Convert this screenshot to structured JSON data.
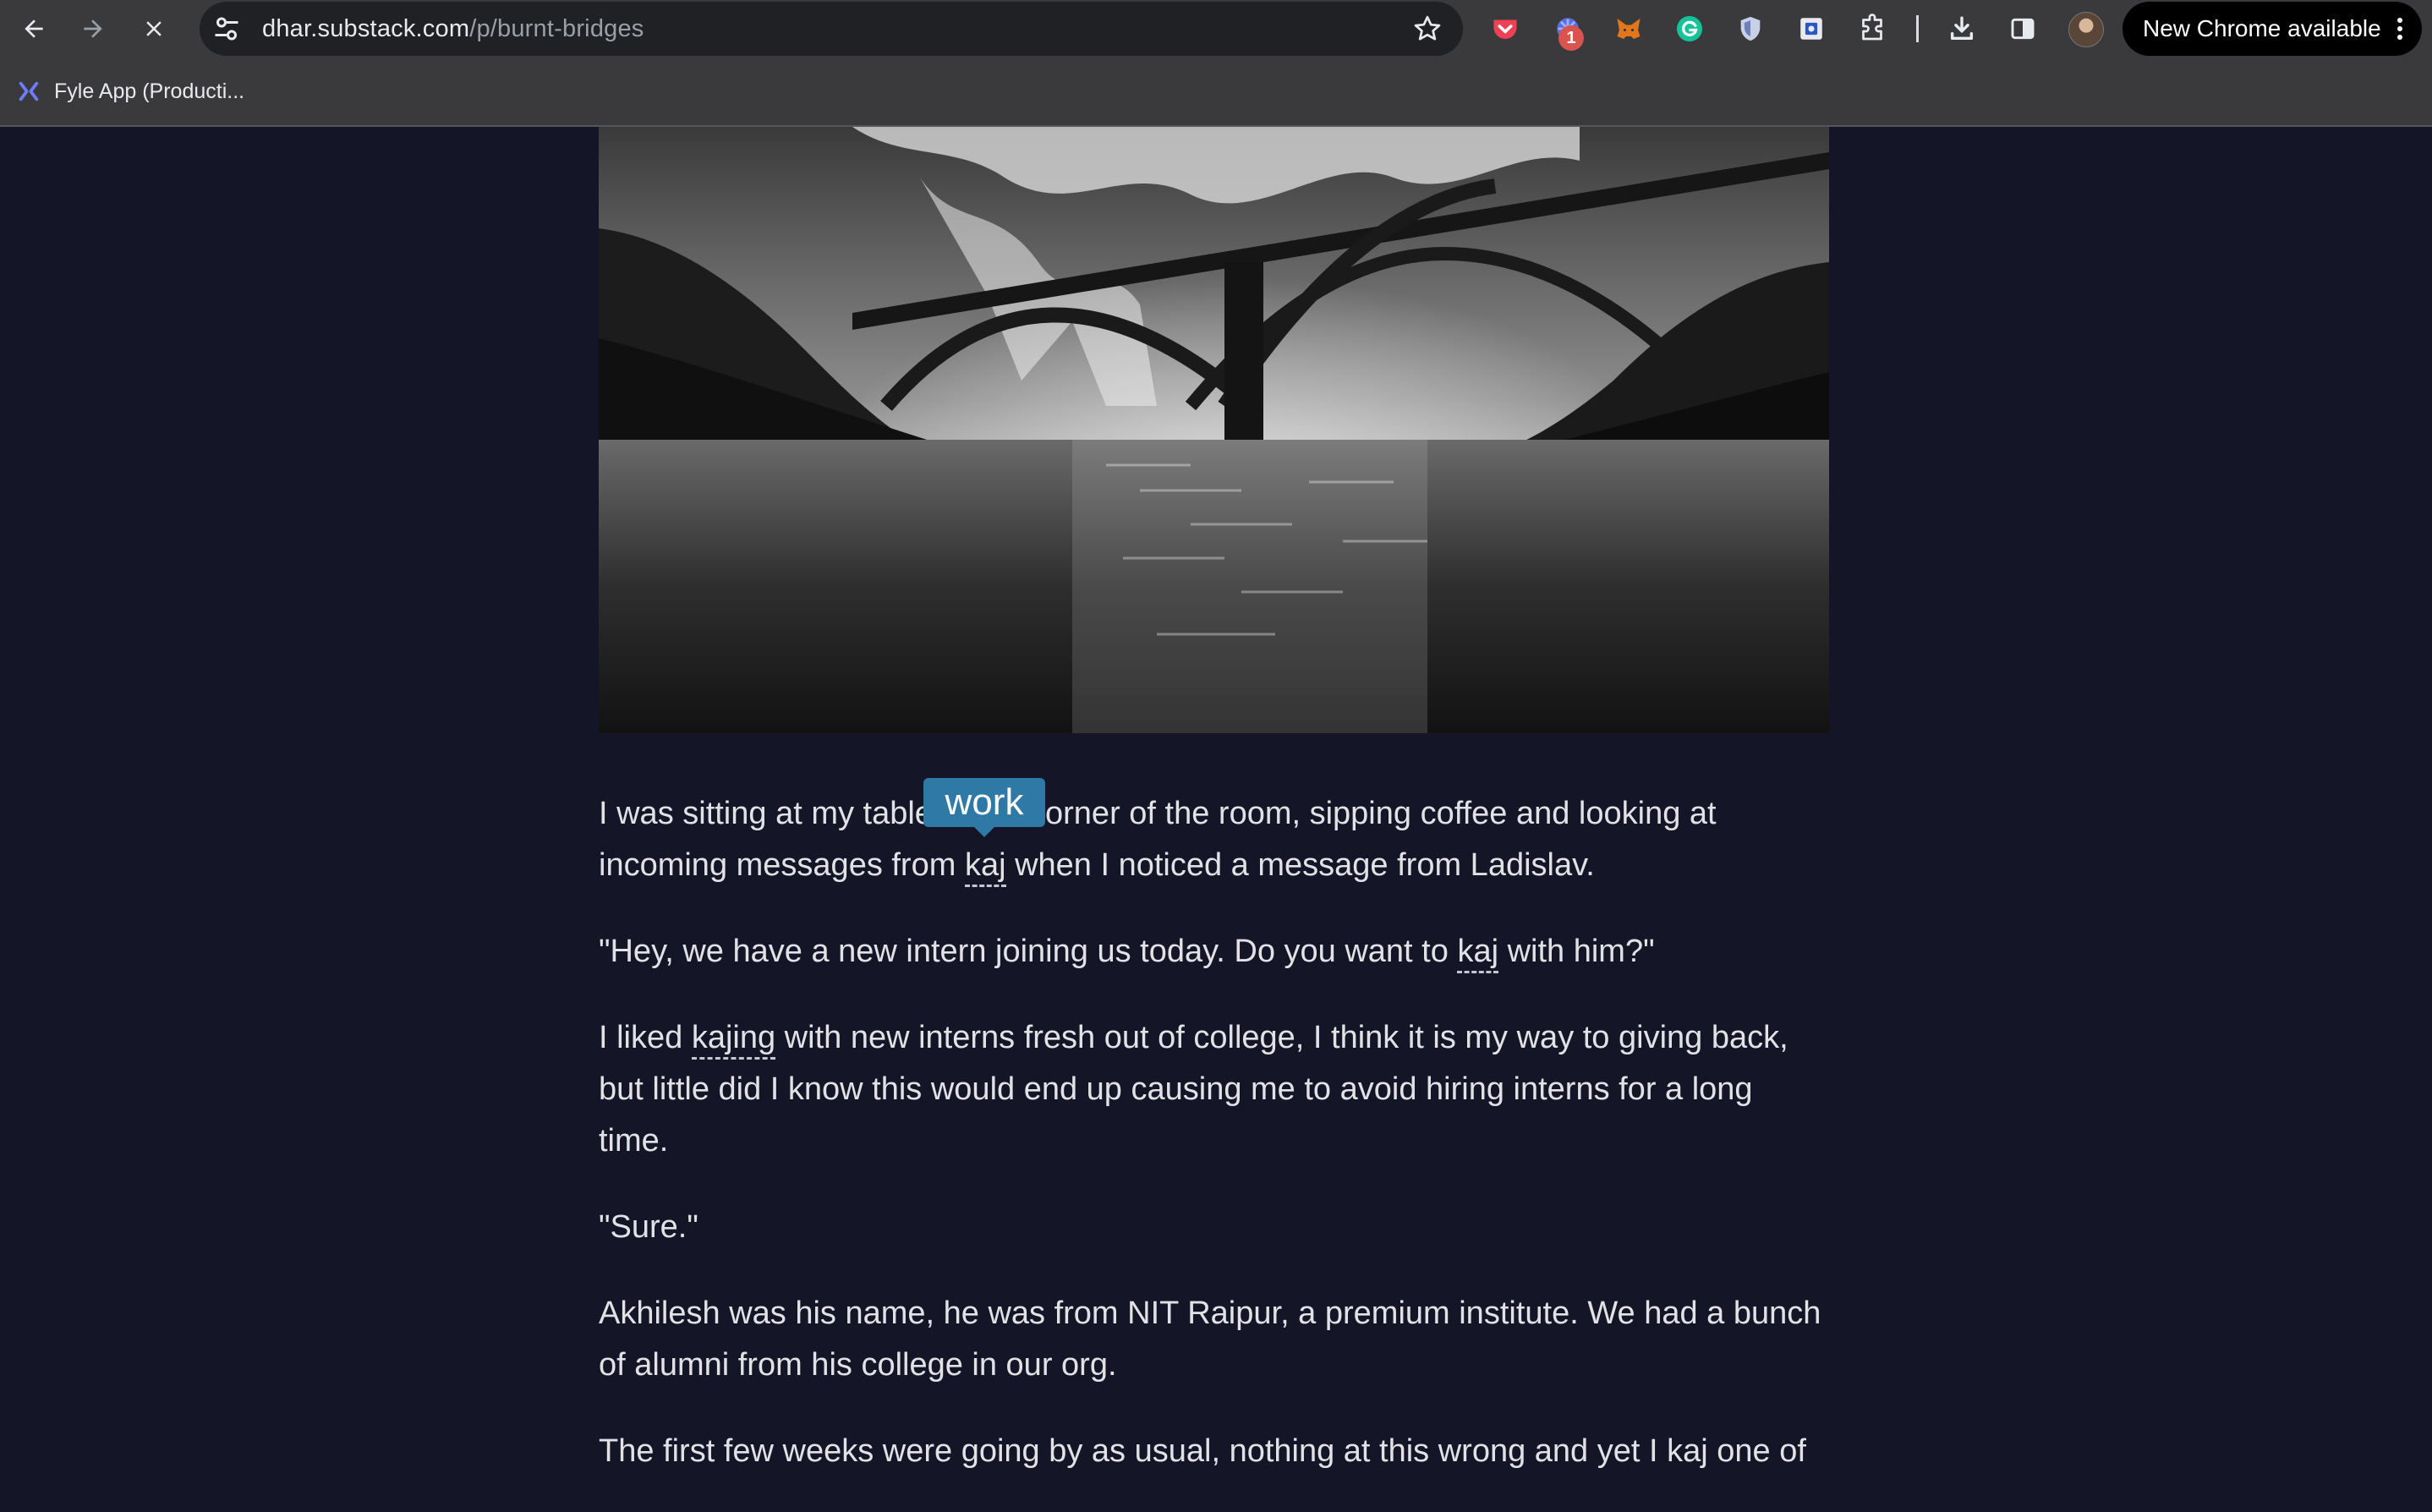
{
  "browser": {
    "url_host": "dhar.substack.com",
    "url_path": "/p/burnt-bridges",
    "extension_badge": "1",
    "update_label": "New Chrome available",
    "bookmark": "Fyle App (Producti..."
  },
  "icons": {
    "back": "arrow-left-icon",
    "forward": "arrow-right-icon",
    "stop": "close-icon",
    "site_info": "tune-icon",
    "bookmark_star": "star-icon",
    "extensions": [
      "pocket-icon",
      "puzzle-badge-icon",
      "metamask-fox-icon",
      "grammarly-icon",
      "shield-icon",
      "square-app-icon",
      "puzzle-icon"
    ],
    "download": "download-icon",
    "side_panel": "side-panel-icon",
    "menu": "kebab-menu-icon"
  },
  "article": {
    "tooltip": "work",
    "p1_a": "I was sitting at my table in the corner of the room, sipping coffee and looking at incoming messages from ",
    "p1_kaj": "kaj",
    "p1_b": " when I noticed a message from Ladislav.",
    "p2_a": "\"Hey, we have a new intern joining us today. Do you want to ",
    "p2_kaj": "kaj",
    "p2_b": " with him?\"",
    "p3_a": "I liked ",
    "p3_kaj": "kajing",
    "p3_b": " with new interns fresh out of college, I think it is my way to giving back, but little did I know this would end up causing me to avoid hiring interns for a long time.",
    "p4": "\"Sure.\"",
    "p5": "Akhilesh was his name, he was from NIT Raipur, a premium institute. We had a bunch of alumni from his college in our org.",
    "p6": "The first few weeks were going by as usual, nothing at this wrong and yet I kaj one of"
  },
  "colors": {
    "page_bg": "#151528",
    "tooltip_bg": "#2f79a7",
    "toolbar_bg": "#3a3a3c"
  }
}
